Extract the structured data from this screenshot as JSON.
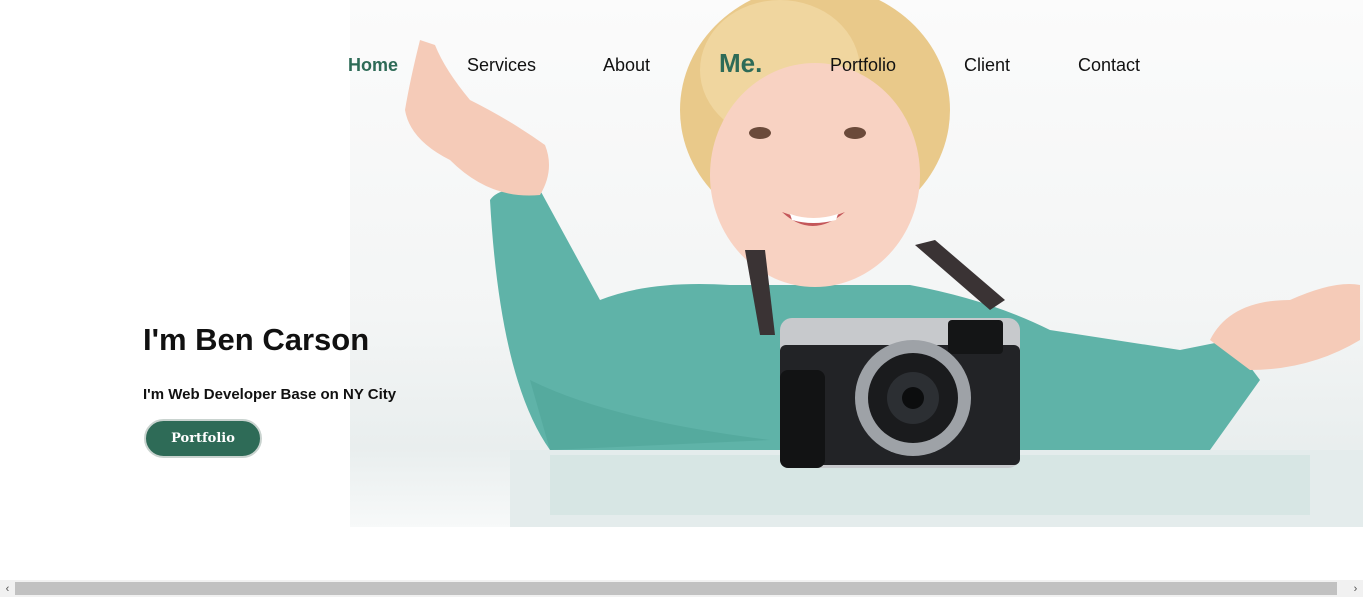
{
  "nav": {
    "items": [
      {
        "label": "Home",
        "active": true
      },
      {
        "label": "Services",
        "active": false
      },
      {
        "label": "About",
        "active": false
      },
      {
        "label": "Portfolio",
        "active": false
      },
      {
        "label": "Client",
        "active": false
      },
      {
        "label": "Contact",
        "active": false
      }
    ],
    "brand": "Me."
  },
  "hero": {
    "title": "I'm Ben Carson",
    "subtitle": "I'm Web Developer Base on NY City",
    "button_label": "Portfolio",
    "image_subject": "smiling-child-with-camera"
  },
  "colors": {
    "accent": "#2e6b57",
    "text": "#111111",
    "background": "#ffffff"
  },
  "scrollbar": {
    "left_arrow": "‹",
    "right_arrow": "›"
  }
}
